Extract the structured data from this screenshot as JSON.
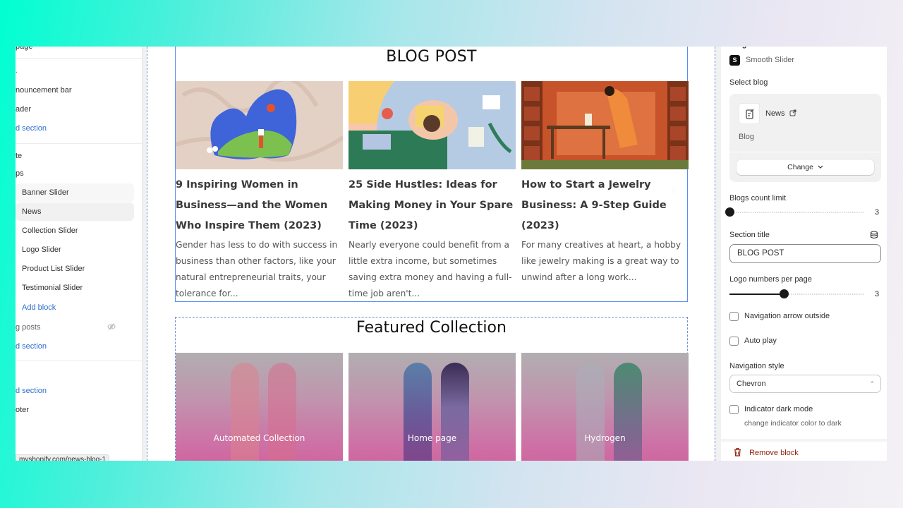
{
  "sidebar": {
    "partial_top": "page",
    "header_group_label": ".",
    "items_header": [
      {
        "label": "nouncement bar"
      },
      {
        "label": "ader"
      }
    ],
    "add_section_1": "d section",
    "template_label": "te",
    "apps_label": "ps",
    "blocks": [
      {
        "label": "Banner Slider",
        "state": "hover"
      },
      {
        "label": "News",
        "state": "active"
      },
      {
        "label": "Collection Slider",
        "state": ""
      },
      {
        "label": "Logo Slider",
        "state": ""
      },
      {
        "label": "Product List Slider",
        "state": ""
      },
      {
        "label": "Testimonial Slider",
        "state": ""
      }
    ],
    "add_block": "Add block",
    "blog_posts_label": "g posts",
    "add_section_2": "d section",
    "add_section_3": "d section",
    "footer_label": "oter",
    "status_url": "myshopify.com/news-blog-1"
  },
  "canvas": {
    "blog_section": {
      "title": "BLOG POST",
      "posts": [
        {
          "title": "9 Inspiring Women in Business—and the Women Who Inspire Them (2023)",
          "excerpt": "Gender has less to do with success in business than other factors, like your natural entrepreneurial traits, your tolerance for..."
        },
        {
          "title": "25 Side Hustles: Ideas for Making Money in Your Spare Time (2023)",
          "excerpt": "Nearly everyone could benefit from a little extra income, but sometimes saving extra money and having a full-time job aren't..."
        },
        {
          "title": "How to Start a Jewelry Business: A 9-Step Guide (2023)",
          "excerpt": "For many creatives at heart, a hobby like jewelry making is a great way to unwind after a long work..."
        }
      ],
      "prev_arrow": "‹",
      "next_arrow": "›"
    },
    "featured_section": {
      "title": "Featured Collection",
      "collections": [
        {
          "label": "Automated Collection"
        },
        {
          "label": "Home page"
        },
        {
          "label": "Hydrogen"
        }
      ]
    }
  },
  "settings": {
    "block_name_partial": "Blog Slider",
    "app_name": "Smooth Slider",
    "app_badge": "S",
    "select_blog_label": "Select blog",
    "blog": {
      "name": "News",
      "type": "Blog"
    },
    "change_button": "Change",
    "blogs_count_limit": {
      "label": "Blogs count limit",
      "value": 3,
      "fill": 0.0
    },
    "section_title": {
      "label": "Section title",
      "value": "BLOG POST"
    },
    "logo_numbers": {
      "label": "Logo numbers per page",
      "value": 3,
      "fill": 0.4
    },
    "nav_arrow_outside": {
      "label": "Navigation arrow outside",
      "checked": false
    },
    "auto_play": {
      "label": "Auto play",
      "checked": false
    },
    "navigation_style": {
      "label": "Navigation style",
      "value": "Chevron"
    },
    "indicator_dark": {
      "label": "Indicator dark mode",
      "help": "change indicator color to dark",
      "checked": false
    },
    "remove_block": "Remove block"
  },
  "colors": {
    "link": "#2c6ecb",
    "selection_outline": "#5b8ef0",
    "danger": "#8e1f0b"
  }
}
